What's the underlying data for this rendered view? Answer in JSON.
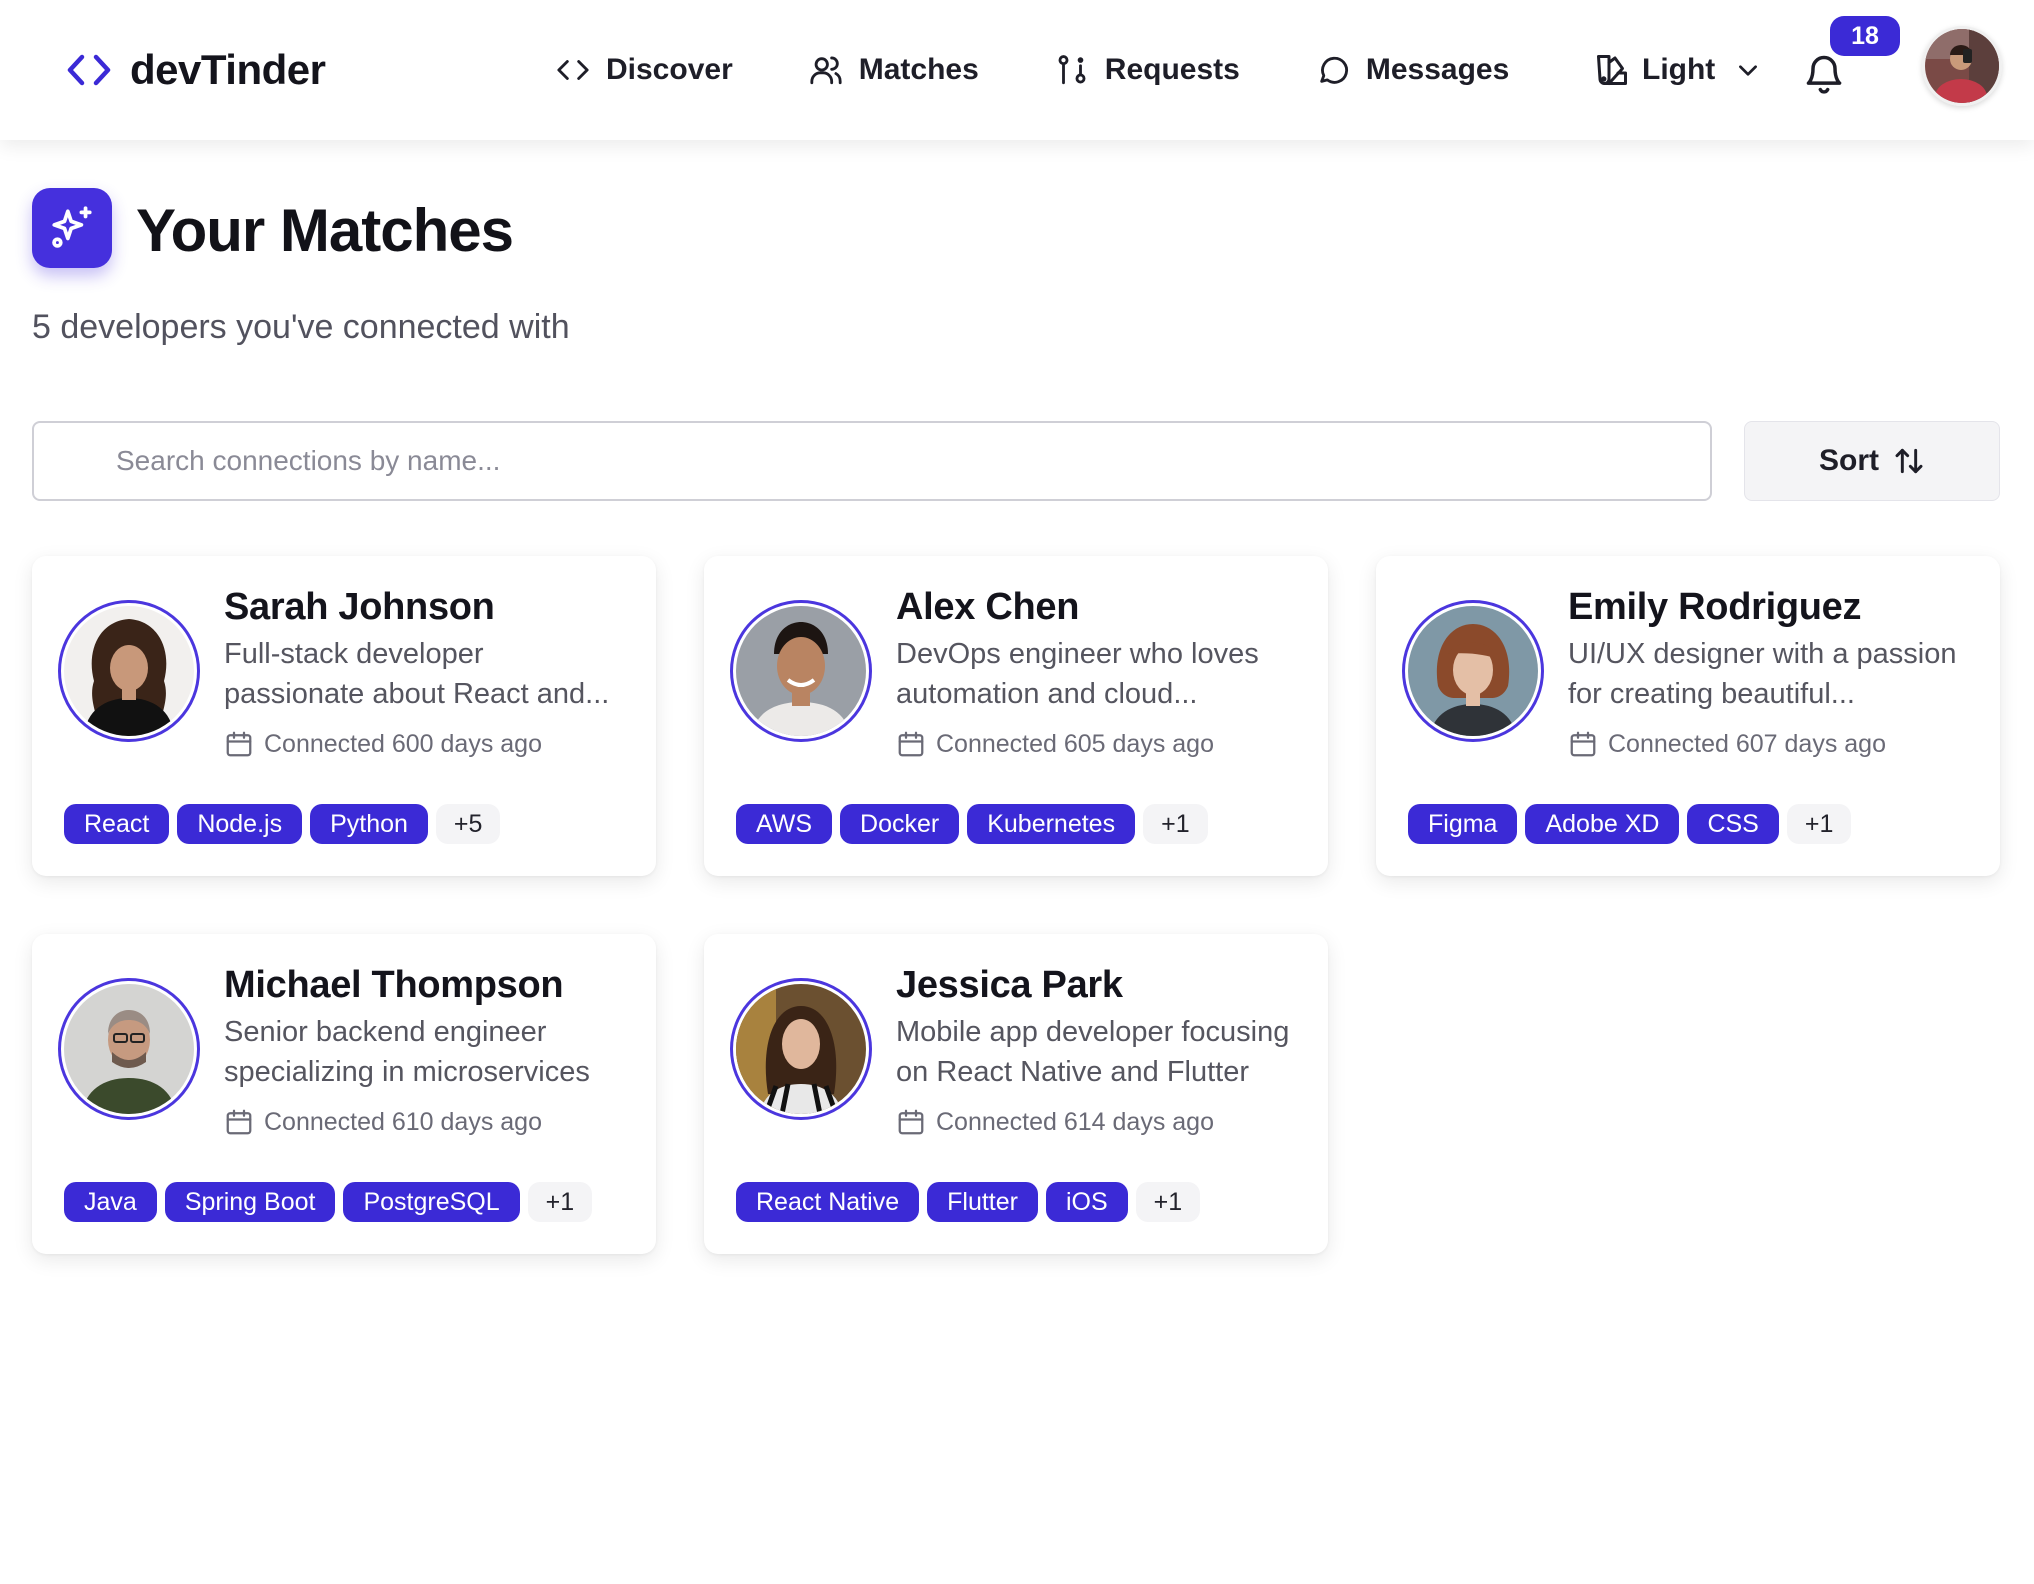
{
  "brand": {
    "name": "devTinder"
  },
  "nav": {
    "links": [
      {
        "label": "Discover",
        "icon": "code-icon"
      },
      {
        "label": "Matches",
        "icon": "users-icon"
      },
      {
        "label": "Requests",
        "icon": "git-pull-request-icon"
      },
      {
        "label": "Messages",
        "icon": "message-circle-icon"
      }
    ],
    "theme_label": "Light",
    "notification_count": "18"
  },
  "header": {
    "title": "Your Matches",
    "subtitle": "5 developers you've connected with"
  },
  "search": {
    "placeholder": "Search connections by name..."
  },
  "sort": {
    "label": "Sort"
  },
  "matches": [
    {
      "name": "Sarah Johnson",
      "bio_line1": "Full-stack developer",
      "bio_line2": "passionate about React and...",
      "connected": "Connected 600 days ago",
      "tags": [
        "React",
        "Node.js",
        "Python"
      ],
      "more": "+5"
    },
    {
      "name": "Alex Chen",
      "bio_line1": "DevOps engineer who loves",
      "bio_line2": "automation and cloud...",
      "connected": "Connected 605 days ago",
      "tags": [
        "AWS",
        "Docker",
        "Kubernetes"
      ],
      "more": "+1"
    },
    {
      "name": "Emily Rodriguez",
      "bio_line1": "UI/UX designer with a passion",
      "bio_line2": "for creating beautiful...",
      "connected": "Connected 607 days ago",
      "tags": [
        "Figma",
        "Adobe XD",
        "CSS"
      ],
      "more": "+1"
    },
    {
      "name": "Michael Thompson",
      "bio_line1": "Senior backend engineer",
      "bio_line2": "specializing in microservices",
      "connected": "Connected 610 days ago",
      "tags": [
        "Java",
        "Spring Boot",
        "PostgreSQL"
      ],
      "more": "+1"
    },
    {
      "name": "Jessica Park",
      "bio_line1": "Mobile app developer focusing",
      "bio_line2": "on React Native and Flutter",
      "connected": "Connected 614 days ago",
      "tags": [
        "React Native",
        "Flutter",
        "iOS"
      ],
      "more": "+1"
    }
  ],
  "colors": {
    "accent": "#3b2ad6",
    "tag_more_bg": "#f4f4f6",
    "text_primary": "#14141c",
    "text_secondary": "#55555f"
  }
}
